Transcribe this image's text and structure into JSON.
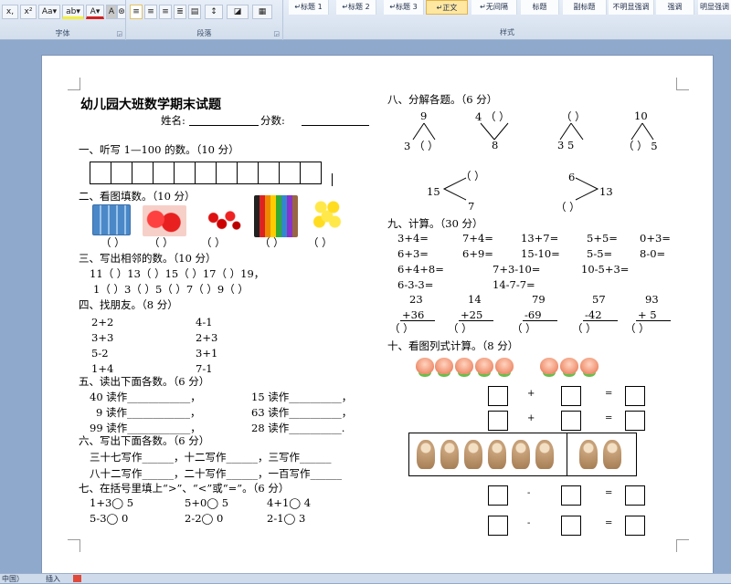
{
  "ribbon": {
    "font_buttons": [
      "x,",
      "x²",
      "Aa▾",
      "ab▾",
      "A▾",
      "A",
      "⊛"
    ],
    "font_group": "字体",
    "paragraph_group": "段落",
    "styles_group": "样式",
    "styles": [
      "↵标题 1",
      "↵标题 2",
      "↵标题 3",
      "↵正文",
      "↵无间隔",
      "标题",
      "副标题",
      "不明显强调",
      "强调",
      "明显强调"
    ]
  },
  "doc": {
    "title": "幼儿园大班数学期末试题",
    "name_label": "姓名:",
    "score_label": "分数:",
    "s1": "一、听写 1—100 的数。（10 分）",
    "s2": "二、看图填数。（10 分）",
    "s2_blanks": [
      "（   ）",
      "（   ）",
      "（   ）",
      "（   ）",
      "（   ）"
    ],
    "s3": "三、写出相邻的数。（10 分）",
    "s3_row1": "11（    ）13（    ）15（    ）17（    ）19，",
    "s3_row2": "1（    ）3（    ）5（    ）7（    ）9（    ）",
    "s4": "四、找朋友。（8 分）",
    "s4_left": [
      "2+2",
      "3+3",
      "5-2",
      "1+4"
    ],
    "s4_right": [
      "4-1",
      "2+3",
      "3+1",
      "7-1"
    ],
    "s5": "五、读出下面各数。（6 分）",
    "s5_items": [
      "40 读作____________，",
      "9 读作____________，",
      "99 读作____________，",
      "15 读作__________，",
      "63 读作__________，",
      "28 读作__________."
    ],
    "s6": "六、写出下面各数。（6 分）",
    "s6_row1": "三十七写作______，十二写作______，三写作______",
    "s6_row2": "八十二写作______，二十写作______，一百写作______",
    "s7": "七、在括号里填上“>”、“<”或“=”。（6 分）",
    "s7_row1": [
      "1+3◯ 5",
      "5+0◯ 5",
      "4+1◯ 4"
    ],
    "s7_row2": [
      "5-3◯ 0",
      "2-2◯ 0",
      "2-1◯ 3"
    ],
    "s8": "八、分解各题。（6 分）",
    "s8_tops": [
      "9",
      "4 （   ）",
      "（   ）",
      "10"
    ],
    "s8_bottoms": [
      "3 （   ）",
      "8",
      "3      5",
      "（   ）  5"
    ],
    "s8_b1": [
      "（   ）",
      "15",
      "7"
    ],
    "s8_b2": [
      "6",
      "13",
      "（   ）"
    ],
    "s9": "九、计算。（30 分）",
    "s9_row1": [
      "3+4=",
      "7+4=",
      "13+7=",
      "5+5=",
      "0+3="
    ],
    "s9_row2": [
      "6+3=",
      "6+9=",
      "15-10=",
      "5-5=",
      "8-0="
    ],
    "s9_row3": [
      "6+4+8=",
      "7+3-10=",
      "10-5+3="
    ],
    "s9_row4": [
      "6-3-3=",
      "14-7-7="
    ],
    "s9_vtop": [
      "23",
      "14",
      "79",
      "57",
      "93"
    ],
    "s9_vbot": [
      "+36",
      "+25",
      "-69",
      "-42",
      "+ 5"
    ],
    "s9_vblank": [
      "（       ）",
      "（       ）",
      "（       ）",
      "（       ）",
      "（       ）"
    ],
    "s10": "十、看图列式计算。（8 分）",
    "ops": [
      "+",
      "=",
      "+",
      "=",
      "-",
      "=",
      "-",
      "="
    ]
  },
  "status": {
    "lang": "中国）",
    "mode": "插入"
  },
  "colors": {
    "ribbon": "#dfe8f5",
    "page": "#ffffff",
    "backdrop": "#8fa9cd",
    "peach": "#f19a7a",
    "monkey": "#c8a27a"
  }
}
